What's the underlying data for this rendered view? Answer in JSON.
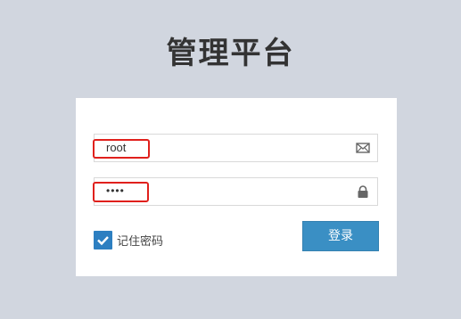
{
  "page": {
    "title": "管理平台"
  },
  "login": {
    "username_value": "root",
    "password_value": "••••",
    "remember_label": "记住密码",
    "remember_checked": true,
    "submit_label": "登录"
  },
  "icons": {
    "username": "envelope-icon",
    "password": "lock-icon",
    "remember": "check-icon"
  },
  "colors": {
    "background": "#d1d6df",
    "panel": "#ffffff",
    "accent": "#3a8fc4",
    "checkbox": "#2d7fc1",
    "highlight": "#e0201c"
  }
}
